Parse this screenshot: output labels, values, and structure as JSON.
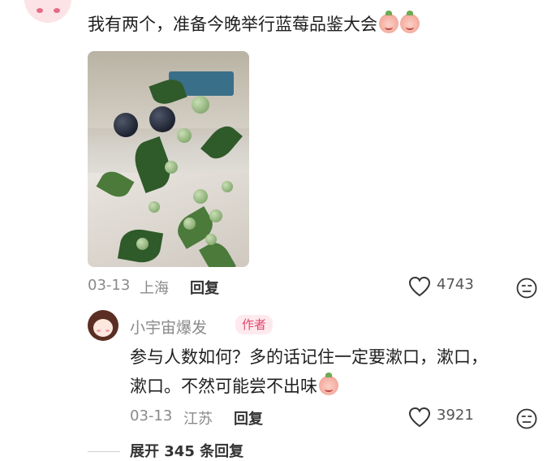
{
  "comment": {
    "text": "我有两个，准备今晚举行蓝莓品鉴大会",
    "emojis": [
      "peach-emoji",
      "peach-emoji"
    ],
    "date": "03-13",
    "location": "上海",
    "reply_label": "回复",
    "like_count": "4743"
  },
  "reply": {
    "username": "小宇宙爆发",
    "badge": "作者",
    "text_line1": "参与人数如何？多的话记住一定要漱口，漱口，",
    "text_line2": "漱口。不然可能尝不出味",
    "emoji": "peach-emoji",
    "date": "03-13",
    "location": "江苏",
    "reply_label": "回复",
    "like_count": "3921"
  },
  "expand_replies": "展开 345 条回复",
  "colors": {
    "badge_text": "#e1476f",
    "badge_bg": "#fde9ee",
    "meta_text": "#8a8a8a"
  }
}
